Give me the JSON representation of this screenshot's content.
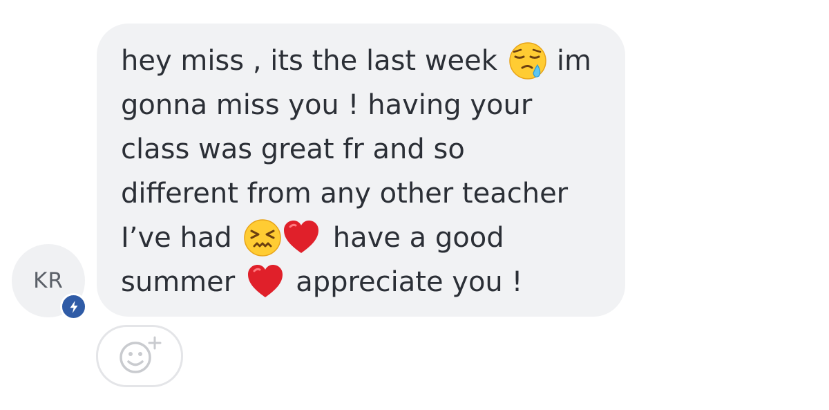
{
  "sender": {
    "initials": "KR",
    "badge_icon": "lightning-bolt-icon",
    "badge_color": "#2f5ba6"
  },
  "message": {
    "segments": {
      "l1a": "hey miss , its the last week",
      "l1b": "im",
      "l2": "gonna miss you ! having your",
      "l3": "class was great fr and so",
      "l4": "different from any other teacher",
      "l5a": "I’ve had",
      "l5b": "have a good",
      "l6a": "summer",
      "l6b": "appreciate you !"
    },
    "emojis": [
      "sleepy-face-emoji",
      "confounded-face-emoji",
      "red-heart-emoji",
      "red-heart-emoji"
    ],
    "bubble_color": "#f1f2f4"
  },
  "reaction": {
    "icon": "add-reaction-icon"
  }
}
